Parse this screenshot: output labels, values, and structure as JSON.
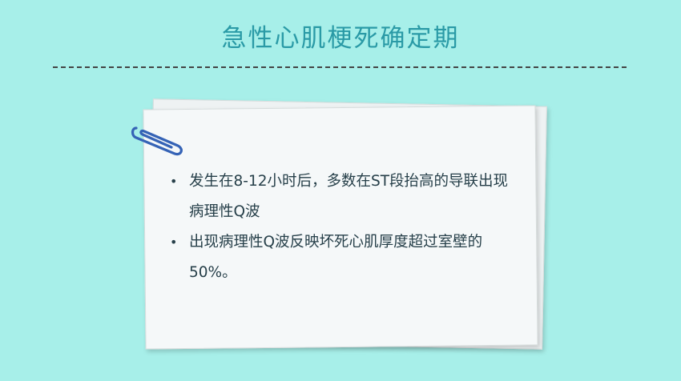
{
  "slide": {
    "title": "急性心肌梗死确定期",
    "bullets": [
      "发生在8-12小时后，多数在ST段抬高的导联出现病理性Q波",
      "出现病理性Q波反映坏死心肌厚度超过室壁的50%。"
    ]
  },
  "icons": {
    "clip": "paperclip-icon",
    "bullet": "bullet-dot-icon"
  },
  "colors": {
    "background": "#a7efe9",
    "title": "#2a9aa6",
    "text": "#27404a",
    "paper": "#f5f8f9",
    "clip": "#3563b6"
  }
}
